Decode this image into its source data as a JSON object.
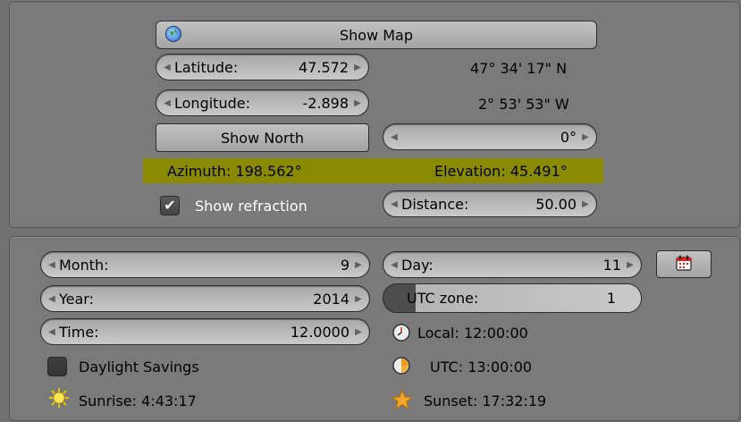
{
  "location": {
    "show_map_label": "Show Map",
    "latitude": {
      "label": "Latitude:",
      "value": "47.572",
      "dms": "47° 34' 17\" N"
    },
    "longitude": {
      "label": "Longitude:",
      "value": "-2.898",
      "dms": "2° 53' 53\" W"
    },
    "show_north_label": "Show North",
    "north_offset_value": "0°",
    "azimuth_text": "Azimuth: 198.562°",
    "elevation_text": "Elevation: 45.491°",
    "show_refraction": {
      "label": "Show refraction",
      "checked": true
    },
    "distance": {
      "label": "Distance:",
      "value": "50.00"
    }
  },
  "time": {
    "month": {
      "label": "Month:",
      "value": "9"
    },
    "day": {
      "label": "Day:",
      "value": "11"
    },
    "year": {
      "label": "Year:",
      "value": "2014"
    },
    "utc_zone": {
      "label": "UTC zone:",
      "value": "1"
    },
    "time": {
      "label": "Time:",
      "value": "12.0000"
    },
    "local_text": "Local: 12:00:00",
    "utc_text": "UTC: 13:00:00",
    "daylight_savings": {
      "label": "Daylight Savings",
      "checked": false
    },
    "sunrise_text": "Sunrise: 4:43:17",
    "sunset_text": "Sunset: 17:32:19"
  },
  "colors": {
    "highlight": "#8a8a00",
    "panel": "#7a7a7a"
  },
  "icons": [
    "globe-icon",
    "calendar-icon",
    "clock-icon",
    "utc-clock-icon",
    "sun-icon",
    "star-icon"
  ]
}
